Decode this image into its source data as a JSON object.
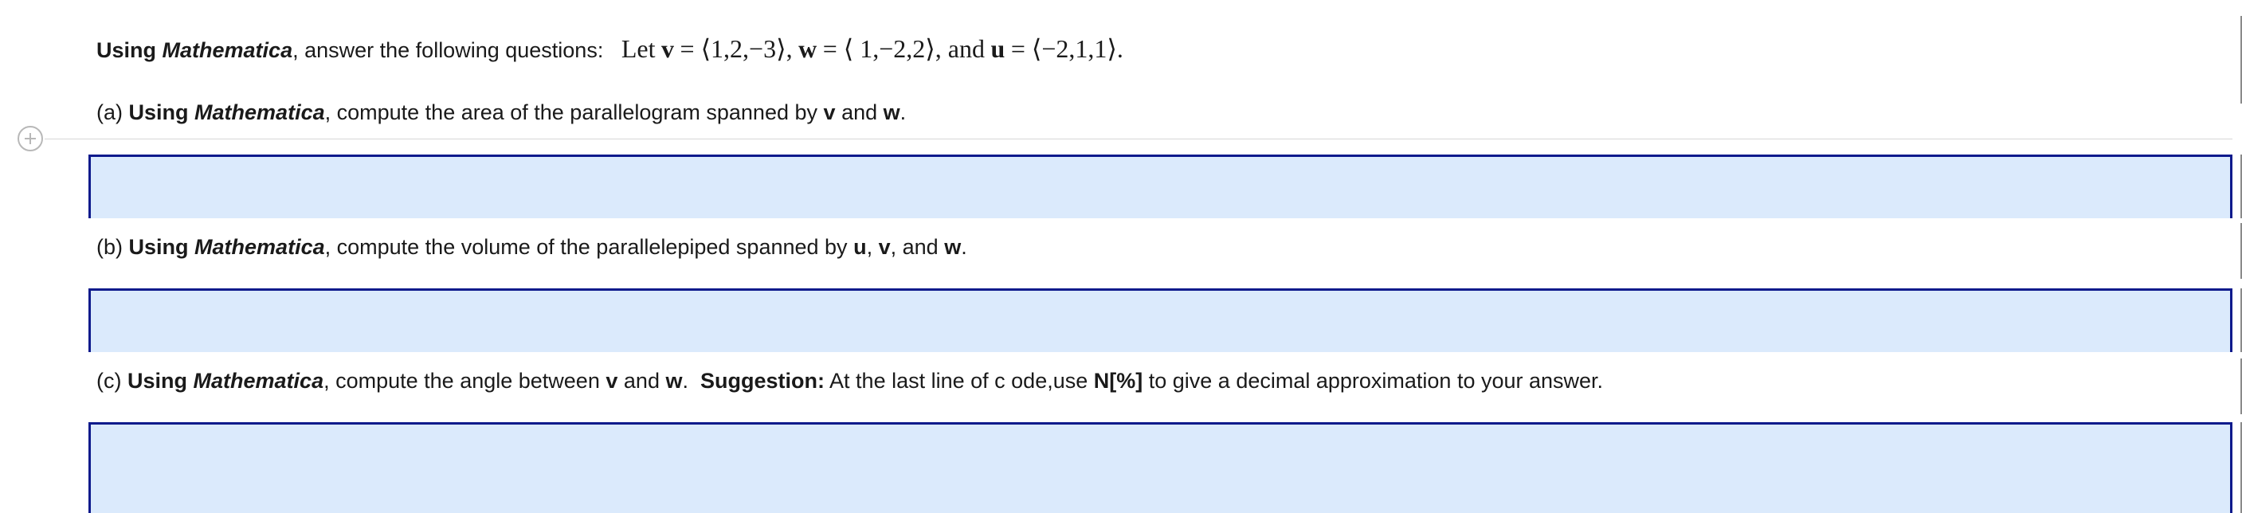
{
  "header": {
    "prefix_bold": "Using",
    "mathematica": "Mathematica",
    "intro": ", answer the following questions:",
    "math_let": "Let",
    "v": "v",
    "v_val": "= ⟨1,2,−3⟩,",
    "w": "w",
    "w_val": "= ⟨ 1,−2,2⟩, and",
    "u": "u",
    "u_val": "= ⟨−2,1,1⟩."
  },
  "questions": [
    {
      "label": "(a)",
      "bold": "Using",
      "mathematica": "Mathematica",
      "text1": ", compute the area of the parallelogram spanned by",
      "v1": "v",
      "and": "and",
      "v2": "w",
      "end": "."
    },
    {
      "label": "(b)",
      "bold": "Using",
      "mathematica": "Mathematica",
      "text1": ", compute the volume of the parallelepiped spanned by",
      "u": "u",
      "comma1": ",",
      "v": "v",
      "comma2": ", and",
      "w": "w",
      "end": "."
    },
    {
      "label": "(c)",
      "bold": "Using",
      "mathematica": "Mathematica",
      "text1": ", compute the angle between",
      "v": "v",
      "and": "and",
      "w": "w",
      "end": ".",
      "suggestion": "Suggestion:",
      "suggest_text": " At  the  last  line  of c ode,use ",
      "code": "N[%]",
      "suggest_end": " to give a decimal  approximation  to  your  answer."
    }
  ]
}
